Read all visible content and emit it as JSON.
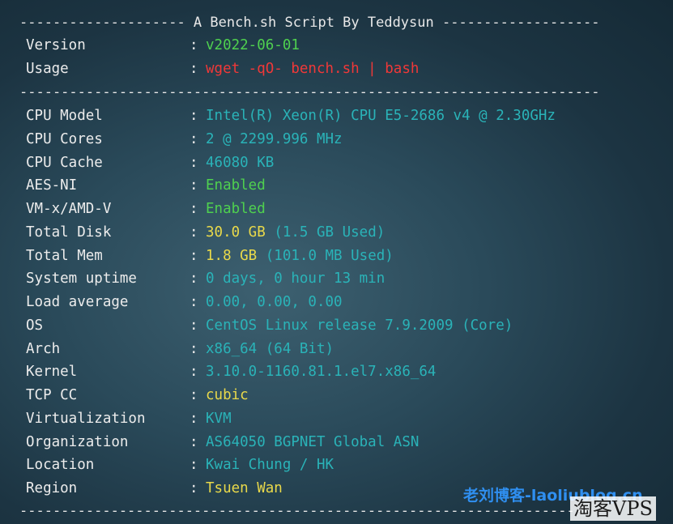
{
  "header": {
    "title_line": "-------------------- A Bench.sh Script By Teddysun -------------------"
  },
  "separator": "----------------------------------------------------------------------",
  "rows_top": [
    {
      "label": "Version",
      "value": "v2022-06-01",
      "color": "#4fd04f"
    },
    {
      "label": "Usage",
      "value": "wget -qO- bench.sh | bash",
      "color": "#f03838"
    }
  ],
  "rows_main": [
    {
      "label": "CPU Model",
      "value": "Intel(R) Xeon(R) CPU E5-2686 v4 @ 2.30GHz",
      "color": "#2ab3b8"
    },
    {
      "label": "CPU Cores",
      "value": "2 @ 2299.996 MHz",
      "color": "#2ab3b8"
    },
    {
      "label": "CPU Cache",
      "value": "46080 KB",
      "color": "#2ab3b8"
    },
    {
      "label": "AES-NI",
      "value": "Enabled",
      "color": "#4fd04f"
    },
    {
      "label": "VM-x/AMD-V",
      "value": "Enabled",
      "color": "#4fd04f"
    },
    {
      "label": "Total Disk",
      "value": "30.0 GB",
      "value2": "(1.5 GB Used)",
      "color": "#e9d94a",
      "color2": "#2ab3b8"
    },
    {
      "label": "Total Mem",
      "value": "1.8 GB",
      "value2": "(101.0 MB Used)",
      "color": "#e9d94a",
      "color2": "#2ab3b8"
    },
    {
      "label": "System uptime",
      "value": "0 days, 0 hour 13 min",
      "color": "#2ab3b8"
    },
    {
      "label": "Load average",
      "value": "0.00, 0.00, 0.00",
      "color": "#2ab3b8"
    },
    {
      "label": "OS",
      "value": "CentOS Linux release 7.9.2009 (Core)",
      "color": "#2ab3b8"
    },
    {
      "label": "Arch",
      "value": "x86_64 (64 Bit)",
      "color": "#2ab3b8"
    },
    {
      "label": "Kernel",
      "value": "3.10.0-1160.81.1.el7.x86_64",
      "color": "#2ab3b8"
    },
    {
      "label": "TCP CC",
      "value": "cubic",
      "color": "#e9d94a"
    },
    {
      "label": "Virtualization",
      "value": "KVM",
      "color": "#2ab3b8"
    },
    {
      "label": "Organization",
      "value": "AS64050 BGPNET Global ASN",
      "color": "#2ab3b8"
    },
    {
      "label": "Location",
      "value": "Kwai Chung / HK",
      "color": "#2ab3b8"
    },
    {
      "label": "Region",
      "value": "Tsuen Wan",
      "color": "#e9d94a"
    }
  ],
  "colon": ":",
  "watermarks": {
    "blog": "老刘博客-laoliublog.cn",
    "brand": "淘客VPS"
  }
}
